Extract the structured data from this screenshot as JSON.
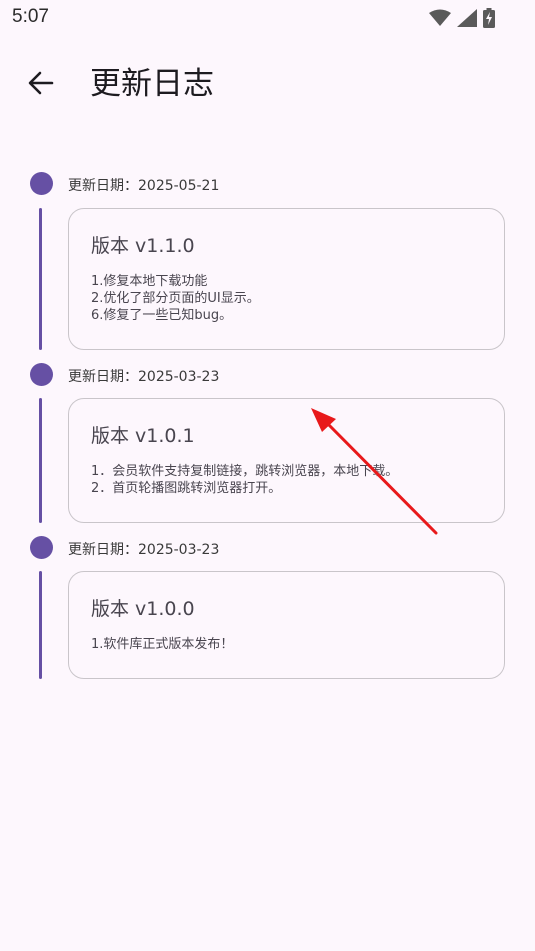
{
  "status_bar": {
    "time": "5:07",
    "icons": [
      "wifi-icon",
      "cell-signal-icon",
      "battery-charging-icon"
    ]
  },
  "app_bar": {
    "back_icon": "arrow-left-icon",
    "title": "更新日志"
  },
  "colors": {
    "accent": "#6650a4",
    "background": "#fdf7fd",
    "card_border": "#c9c5ca",
    "annotation_arrow": "#e8191b"
  },
  "entries": [
    {
      "date": "更新日期：2025-05-21",
      "version": "版本 v1.1.0",
      "notes": "1.修复本地下载功能\n2.优化了部分页面的UI显示。\n6.修复了一些已知bug。"
    },
    {
      "date": "更新日期：2025-03-23",
      "version": "版本 v1.0.1",
      "notes": "1．会员软件支持复制链接，跳转浏览器，本地下载。\n2．首页轮播图跳转浏览器打开。"
    },
    {
      "date": "更新日期：2025-03-23",
      "version": "版本 v1.0.0",
      "notes": "1.软件库正式版本发布！"
    }
  ]
}
